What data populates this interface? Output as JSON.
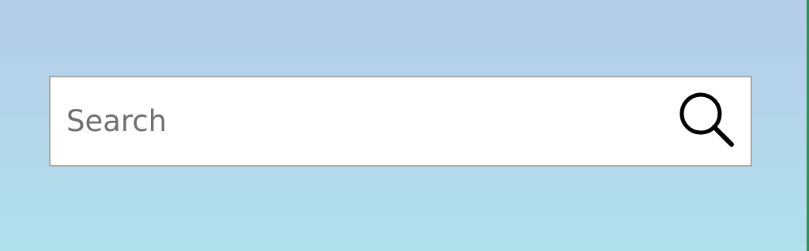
{
  "search": {
    "placeholder": "Search",
    "value": "",
    "button_icon": "search-icon"
  },
  "colors": {
    "background_top": "#b5cde8",
    "background_bottom": "#b0e0ec",
    "box_border": "#a9a9a9",
    "placeholder_text": "#6f6f6f",
    "icon": "#000000",
    "edge_accent": "#2f8f5a"
  }
}
